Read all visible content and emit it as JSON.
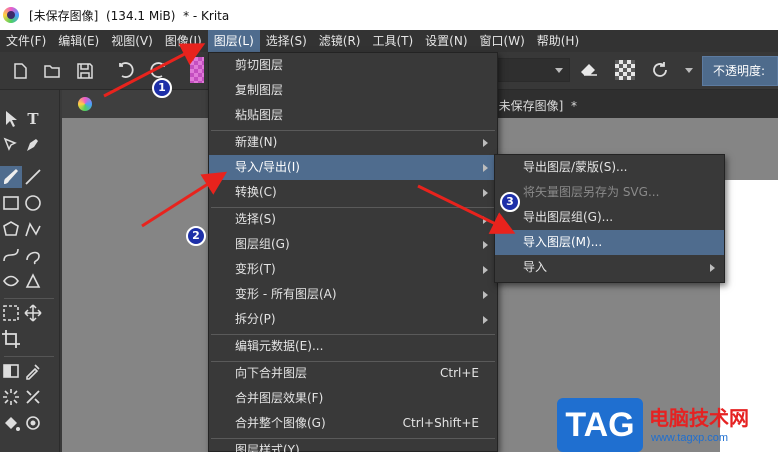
{
  "window": {
    "title": "[未保存图像]  (134.1 MiB)  * - Krita",
    "app_icon": "krita-logo-icon"
  },
  "menubar": {
    "items": [
      {
        "label": "文件(F)"
      },
      {
        "label": "编辑(E)"
      },
      {
        "label": "视图(V)"
      },
      {
        "label": "图像(I)"
      },
      {
        "label": "图层(L)",
        "active": true
      },
      {
        "label": "选择(S)"
      },
      {
        "label": "滤镜(R)"
      },
      {
        "label": "工具(T)"
      },
      {
        "label": "设置(N)"
      },
      {
        "label": "窗口(W)"
      },
      {
        "label": "帮助(H)"
      }
    ]
  },
  "toolbar": {
    "icons": [
      "new-document-icon",
      "open-folder-icon",
      "save-icon",
      "undo-icon",
      "redo-icon",
      "eraser-icon",
      "alpha-lock-icon",
      "reload-preset-icon"
    ],
    "opacity_label": "不透明度:"
  },
  "document_tab": {
    "title": "[未保存图像]  *"
  },
  "layer_menu": {
    "items": [
      {
        "label": "剪切图层"
      },
      {
        "label": "复制图层"
      },
      {
        "label": "粘贴图层"
      },
      {
        "label": "新建(N)",
        "submenu": true
      },
      {
        "label": "导入/导出(I)",
        "submenu": true,
        "highlighted": true
      },
      {
        "label": "转换(C)",
        "submenu": true
      },
      {
        "label": "选择(S)",
        "submenu": true
      },
      {
        "label": "图层组(G)",
        "submenu": true
      },
      {
        "label": "变形(T)",
        "submenu": true
      },
      {
        "label": "变形 - 所有图层(A)",
        "submenu": true
      },
      {
        "label": "拆分(P)",
        "submenu": true
      },
      {
        "label": "编辑元数据(E)..."
      },
      {
        "label": "向下合并图层",
        "shortcut": "Ctrl+E"
      },
      {
        "label": "合并图层效果(F)"
      },
      {
        "label": "合并整个图像(G)",
        "shortcut": "Ctrl+Shift+E"
      },
      {
        "label": "图层样式(Y)..."
      }
    ]
  },
  "import_export_submenu": {
    "items": [
      {
        "label": "导出图层/蒙版(S)..."
      },
      {
        "label": "将矢量图层另存为 SVG...",
        "disabled": true
      },
      {
        "label": "导出图层组(G)..."
      },
      {
        "label": "导入图层(M)...",
        "highlighted": true
      },
      {
        "label": "导入",
        "submenu": true
      }
    ]
  },
  "annotations": {
    "badges": [
      "1",
      "2",
      "3"
    ],
    "arrow_color": "#e8231d"
  },
  "watermark": {
    "tag": "TAG",
    "site_name": "电脑技术网",
    "url": "www.tagxp.com"
  },
  "colors": {
    "menu_highlight": "#4f6c8e",
    "menu_bg": "#393939",
    "canvas_gray": "#858585"
  }
}
